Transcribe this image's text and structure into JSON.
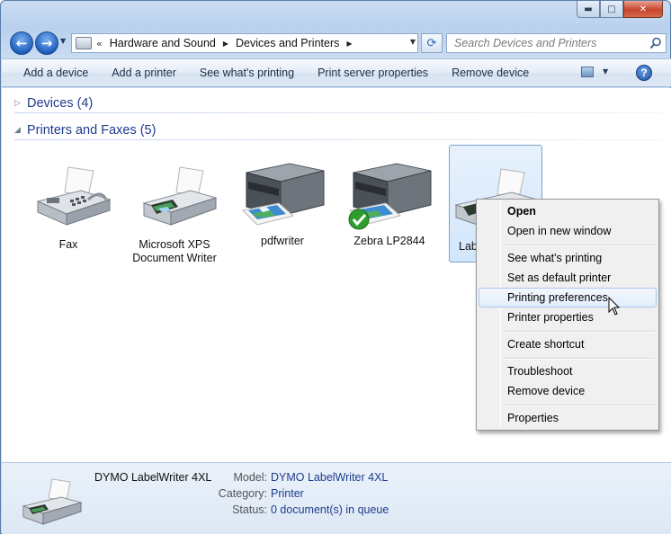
{
  "window": {
    "caption_buttons": {
      "minimize": "▬",
      "maximize": "□",
      "close": "✕"
    }
  },
  "nav": {
    "back_glyph": "←",
    "forward_glyph": "→",
    "chevron": "«",
    "breadcrumbs": [
      "Hardware and Sound",
      "Devices and Printers"
    ],
    "refresh_glyph": "⟳",
    "search_placeholder": "Search Devices and Printers"
  },
  "commands": [
    "Add a device",
    "Add a printer",
    "See what's printing",
    "Print server properties",
    "Remove device"
  ],
  "help_label": "?",
  "groups": {
    "devices": {
      "label": "Devices (4)",
      "expanded": false
    },
    "printers": {
      "label": "Printers and Faxes (5)",
      "expanded": true
    }
  },
  "printers": [
    {
      "name": "Fax",
      "icon": "fax-icon"
    },
    {
      "name": "Microsoft XPS Document Writer",
      "icon": "printer-icon"
    },
    {
      "name": "pdfwriter",
      "icon": "laser-printer-icon"
    },
    {
      "name": "Zebra LP2844",
      "icon": "laser-printer-icon",
      "default": true
    },
    {
      "name": "Lab",
      "icon": "printer-icon",
      "selected": true
    }
  ],
  "context_menu": {
    "items": [
      {
        "label": "Open",
        "bold": true
      },
      {
        "label": "Open in new window"
      },
      {
        "label": "See what's printing"
      },
      {
        "label": "Set as default printer"
      },
      {
        "label": "Printing preferences",
        "hover": true
      },
      {
        "label": "Printer properties"
      },
      {
        "label": "Create shortcut"
      },
      {
        "label": "Troubleshoot"
      },
      {
        "label": "Remove device"
      },
      {
        "label": "Properties"
      }
    ]
  },
  "details": {
    "name": "DYMO LabelWriter 4XL",
    "model_label": "Model:",
    "model": "DYMO LabelWriter 4XL",
    "category_label": "Category:",
    "category": "Printer",
    "status_label": "Status:",
    "status": "0 document(s) in queue"
  },
  "colors": {
    "accent": "#1e3d8f",
    "selection": "#d3e6fb",
    "default_check": "#2e9d2e"
  }
}
